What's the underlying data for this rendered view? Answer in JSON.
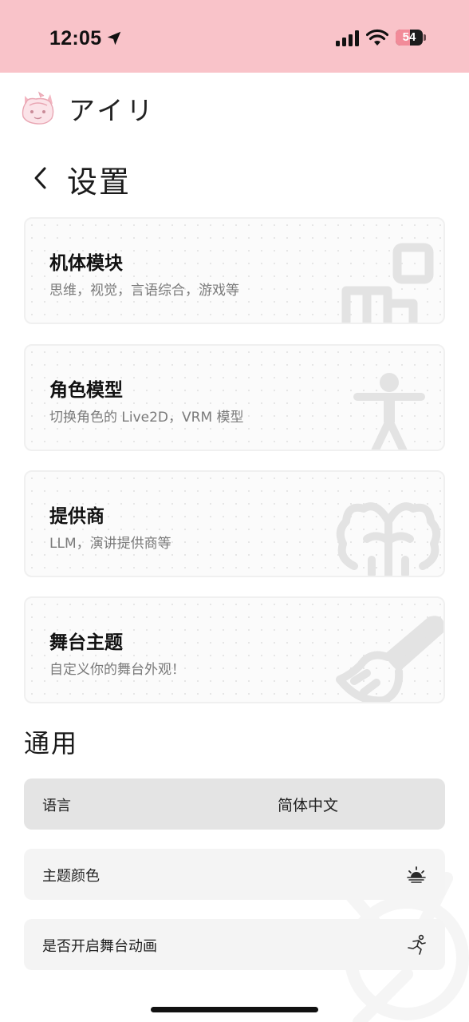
{
  "status_bar": {
    "time": "12:05",
    "battery": "54",
    "battery_level": 0.54,
    "background_color": "#f9c3c9"
  },
  "app": {
    "title": "アイリ",
    "logo_icon": "cat-mascot-icon"
  },
  "page": {
    "title": "设置",
    "back_icon": "chevron-left-icon"
  },
  "cards": [
    {
      "title": "机体模块",
      "description": "思维，视觉，言语综合，游戏等",
      "icon": "modules-icon"
    },
    {
      "title": "角色模型",
      "description": "切换角色的 Live2D，VRM 模型",
      "icon": "person-figure-icon"
    },
    {
      "title": "提供商",
      "description": "LLM，演讲提供商等",
      "icon": "brain-icon"
    },
    {
      "title": "舞台主题",
      "description": "自定义你的舞台外观！",
      "icon": "paint-brush-icon"
    }
  ],
  "general": {
    "title": "通用",
    "language": {
      "label": "语言",
      "value": "简体中文"
    },
    "theme_color": {
      "label": "主题颜色",
      "icon": "sunset-icon"
    },
    "stage_animation": {
      "label": "是否开启舞台动画",
      "icon": "running-person-icon"
    }
  }
}
